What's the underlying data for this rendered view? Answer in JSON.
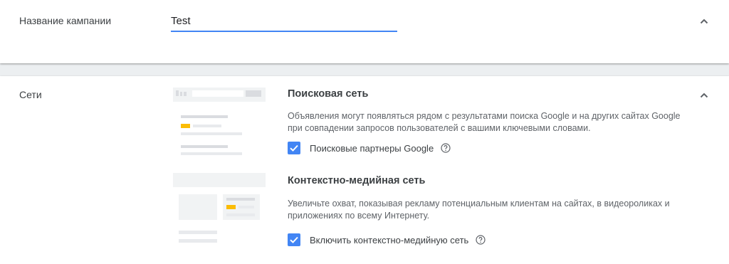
{
  "campaign": {
    "label": "Название кампании",
    "value": "Test"
  },
  "networks": {
    "label": "Сети",
    "search": {
      "title": "Поисковая сеть",
      "description": "Объявления могут появляться рядом с результатами поиска Google и на других сайтах Google при совпадении запросов пользователей с вашими ключевыми словами.",
      "checkbox_label": "Поисковые партнеры Google",
      "checked": true
    },
    "display": {
      "title": "Контекстно-медийная сеть",
      "description": "Увеличьте охват, показывая рекламу потенциальным клиентам на сайтах, в видеороликах и приложениях по всему Интернету.",
      "checkbox_label": "Включить контекстно-медийную сеть",
      "checked": true
    }
  },
  "icons": {
    "collapse": "chevron-up-icon",
    "help": "help-circle-icon",
    "check": "check-icon"
  },
  "colors": {
    "accent": "#4285f4",
    "highlight": "#fbbc04",
    "background": "#eceff1"
  }
}
